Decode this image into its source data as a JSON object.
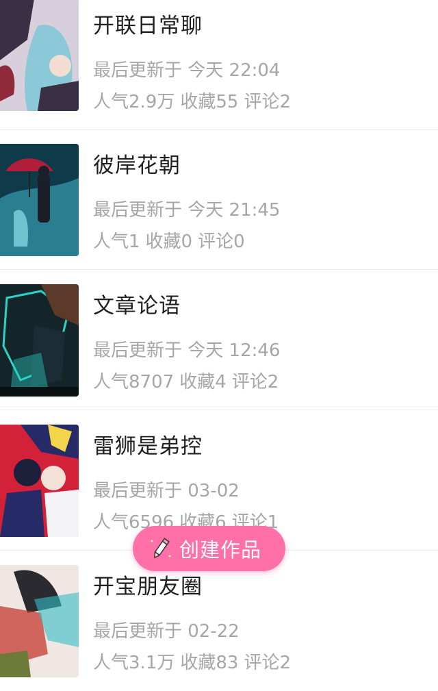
{
  "works": [
    {
      "title": "开联日常聊",
      "updated": "最后更新于 今天 22:04",
      "popularity": "人气2.9万",
      "favorites": "收藏55",
      "comments": "评论2",
      "cover_colors": [
        "#d8cfdc",
        "#7ec8d8",
        "#3a3046"
      ]
    },
    {
      "title": "彼岸花朝",
      "updated": "最后更新于 今天 21:45",
      "popularity": "人气1",
      "favorites": "收藏0",
      "comments": "评论0",
      "cover_colors": [
        "#0f3a4a",
        "#3fb6c8",
        "#b11e3a"
      ]
    },
    {
      "title": "文章论语",
      "updated": "最后更新于 今天 12:46",
      "popularity": "人气8707",
      "favorites": "收藏4",
      "comments": "评论2",
      "cover_colors": [
        "#14252a",
        "#2bd4c6",
        "#5b3a2a"
      ]
    },
    {
      "title": "雷狮是弟控",
      "updated": "最后更新于 03-02",
      "popularity": "人气6596",
      "favorites": "收藏6",
      "comments": "评论1",
      "cover_colors": [
        "#d4213a",
        "#262a66",
        "#f2d54a"
      ]
    },
    {
      "title": "开宝朋友圈",
      "updated": "最后更新于 02-22",
      "popularity": "人气3.1万",
      "favorites": "收藏83",
      "comments": "评论2",
      "cover_colors": [
        "#f0e6e2",
        "#c43a30",
        "#34c0c8"
      ]
    }
  ],
  "fab": {
    "label": "创建作品",
    "icon": "pencil-icon",
    "color": "#ff6fa8"
  },
  "colors": {
    "title": "#1f1f1f",
    "meta": "#a6a6a6",
    "divider": "#e9e9e9"
  }
}
